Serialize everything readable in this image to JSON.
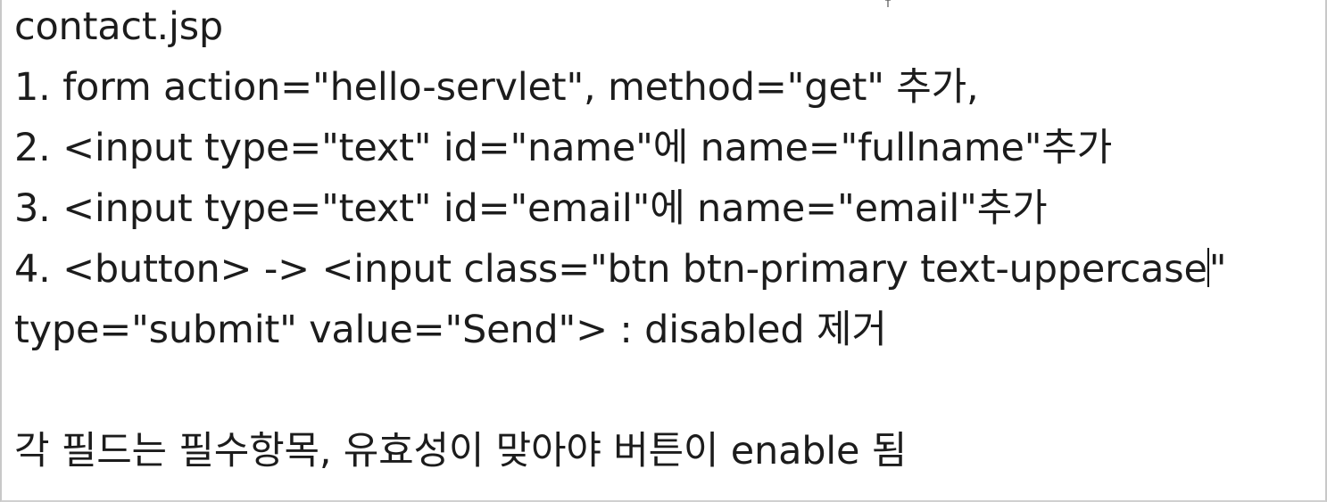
{
  "document": {
    "lines": [
      "contact.jsp",
      "1. form action=\"hello-servlet\", method=\"get\" 추가,",
      "2. <input type=\"text\" id=\"name\"에 name=\"fullname\"추가",
      "3. <input type=\"text\" id=\"email\"에 name=\"email\"추가",
      "4. <button> -> <input class=\"btn btn-primary text-uppercase",
      "type=\"submit\" value=\"Send\"> : disabled 제거",
      "",
      "각 필드는 필수항목, 유효성이 맞아야 버튼이 enable 됨"
    ],
    "line4_after_caret": "\""
  }
}
